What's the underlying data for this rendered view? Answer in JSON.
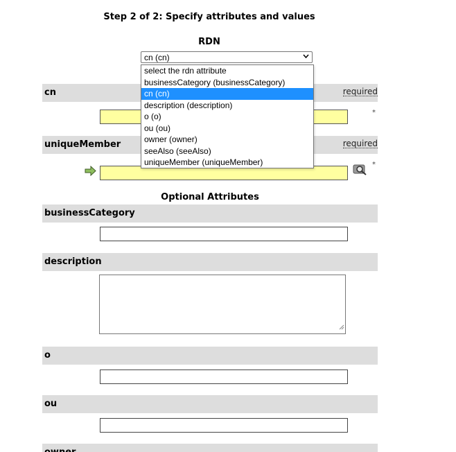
{
  "step_title": "Step 2 of 2: Specify attributes and values",
  "rdn": {
    "label": "RDN",
    "selected": "cn (cn)",
    "options": [
      "select the rdn attribute",
      "businessCategory (businessCategory)",
      "cn (cn)",
      "description (description)",
      "o (o)",
      "ou (ou)",
      "owner (owner)",
      "seeAlso (seeAlso)",
      "uniqueMember (uniqueMember)"
    ],
    "highlighted_index": 2
  },
  "required_attributes": [
    {
      "name": "cn",
      "required_label": "required",
      "star": "*"
    },
    {
      "name": "uniqueMember",
      "required_label": "required",
      "star": "*"
    }
  ],
  "optional_title": "Optional Attributes",
  "optional_attributes": [
    {
      "name": "businessCategory"
    },
    {
      "name": "description"
    },
    {
      "name": "o"
    },
    {
      "name": "ou"
    },
    {
      "name": "owner"
    }
  ],
  "colors": {
    "row_header_bg": "#dddddd",
    "required_input_bg": "#ffffa0",
    "highlight": "#1e90ff"
  },
  "icons": [
    "arrow-right-icon",
    "lookup-magnifier-icon",
    "dropdown-chevron-icon",
    "resize-grip-icon"
  ]
}
